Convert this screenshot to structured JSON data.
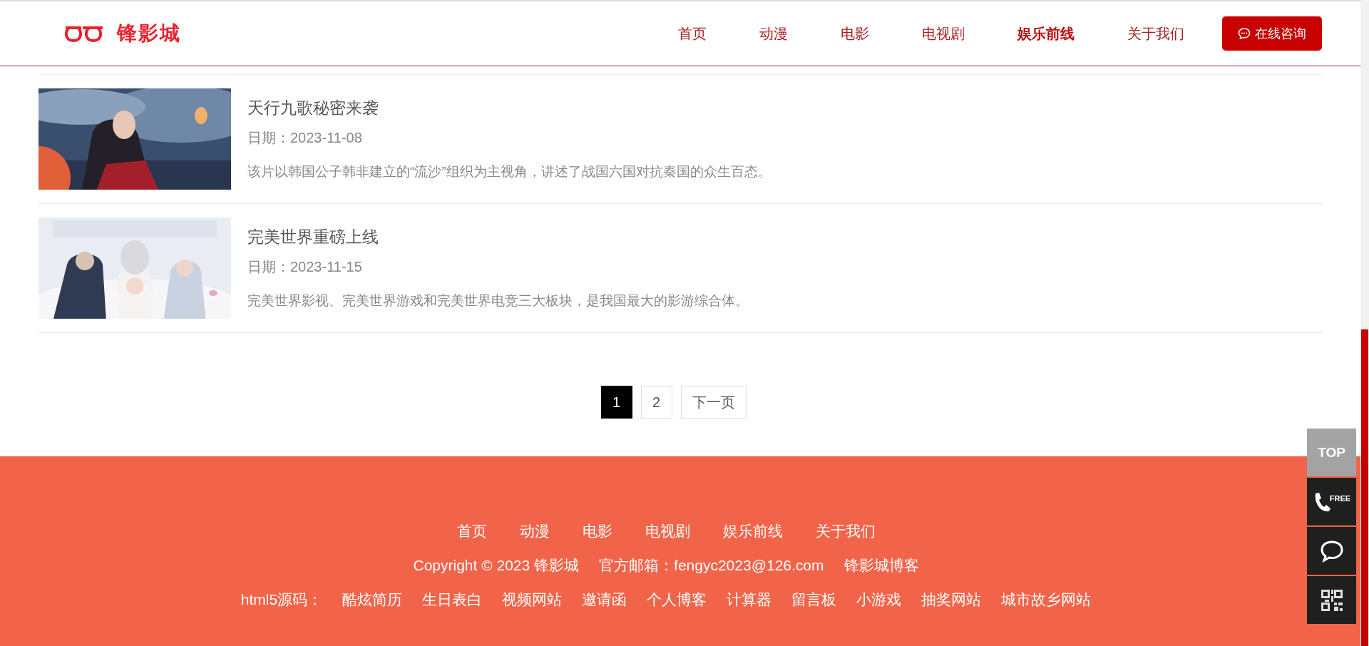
{
  "header": {
    "logo_text": "锋影城",
    "nav": [
      {
        "label": "首页",
        "selected": false
      },
      {
        "label": "动漫",
        "selected": false
      },
      {
        "label": "电影",
        "selected": false
      },
      {
        "label": "电视剧",
        "selected": false
      },
      {
        "label": "娱乐前线",
        "selected": true
      },
      {
        "label": "关于我们",
        "selected": false
      }
    ],
    "consult_button": "在线咨询"
  },
  "articles": [
    {
      "title": "天行九歌秘密来袭",
      "date": "日期：2023-11-08",
      "summary": "该片以韩国公子韩非建立的“流沙”组织为主视角，讲述了战国六国对抗秦国的众生百态。"
    },
    {
      "title": "完美世界重磅上线",
      "date": "日期：2023-11-15",
      "summary": "完美世界影视、完美世界游戏和完美世界电竞三大板块，是我国最大的影游综合体。"
    }
  ],
  "pagination": [
    {
      "label": "1",
      "selected": true
    },
    {
      "label": "2",
      "selected": false
    },
    {
      "label": "下一页",
      "selected": false
    }
  ],
  "footer": {
    "nav": [
      "首页",
      "动漫",
      "电影",
      "电视剧",
      "娱乐前线",
      "关于我们"
    ],
    "copyright": "Copyright © 2023 锋影城",
    "email": "官方邮箱：fengyc2023@126.com",
    "blog": "锋影城博客",
    "source_label": "html5源码：",
    "source_links": [
      "酷炫简历",
      "生日表白",
      "视频网站",
      "邀请函",
      "个人博客",
      "计算器",
      "留言板",
      "小游戏",
      "抽奖网站",
      "城市故乡网站"
    ]
  },
  "side_tools": {
    "top": "TOP",
    "free": "FREE"
  }
}
